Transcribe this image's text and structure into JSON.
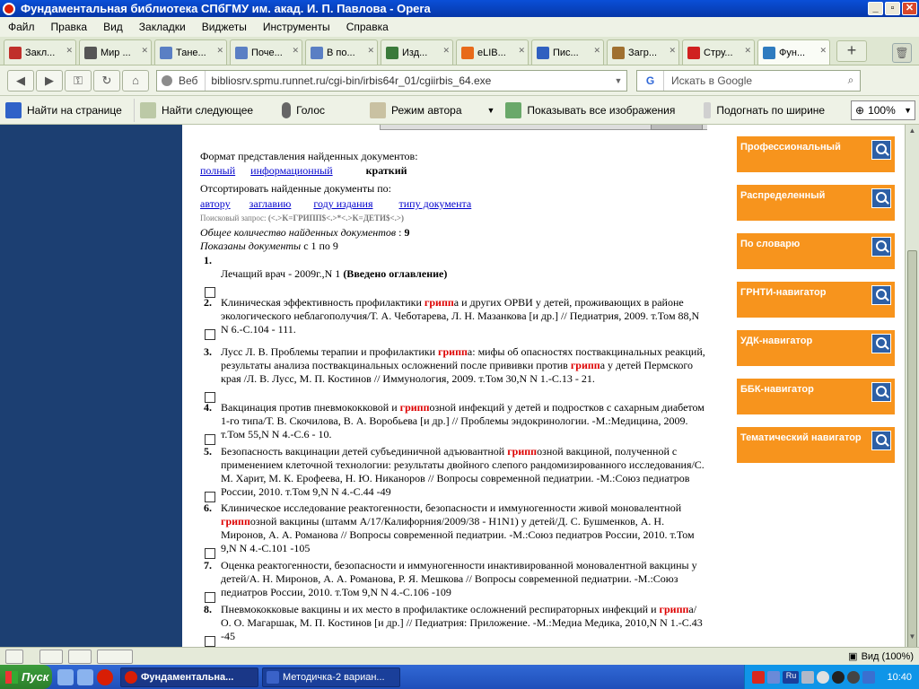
{
  "window": {
    "title": "Фундаментальная библиотека СПбГМУ им. акад. И. П. Павлова - Opera"
  },
  "menu": [
    "Файл",
    "Правка",
    "Вид",
    "Закладки",
    "Виджеты",
    "Инструменты",
    "Справка"
  ],
  "tabs": [
    {
      "label": "Закл...",
      "color": "#c0302b"
    },
    {
      "label": "Мир ...",
      "color": "#555"
    },
    {
      "label": "Тане...",
      "color": "#5a7fc4"
    },
    {
      "label": "Поче...",
      "color": "#5a7fc4"
    },
    {
      "label": "В по...",
      "color": "#5a7fc4"
    },
    {
      "label": "Изд...",
      "color": "#3a7a3a"
    },
    {
      "label": "eLIB...",
      "color": "#e86a1a"
    },
    {
      "label": "Пис...",
      "color": "#3060c0"
    },
    {
      "label": "Загр...",
      "color": "#a07030"
    },
    {
      "label": "Стру...",
      "color": "#d02020"
    },
    {
      "label": "Фун...",
      "color": "#2e7bbf"
    }
  ],
  "address": {
    "label": "Веб",
    "url": "bibliosrv.spmu.runnet.ru/cgi-bin/irbis64r_01/cgiirbis_64.exe"
  },
  "search": {
    "placeholder": "Искать в Google",
    "engine": "G"
  },
  "toolbar2": {
    "find": "Найти на странице",
    "find_next": "Найти следующее",
    "voice": "Голос",
    "author_mode": "Режим автора",
    "show_images": "Показывать все изображения",
    "fit_width": "Подогнать по ширине",
    "zoom": "100%"
  },
  "content": {
    "format_label": "Формат представления найденных документов:",
    "formats": [
      "полный",
      "информационный"
    ],
    "format_current": "краткий",
    "sort_label": "Отсортировать найденные документы по:",
    "sort_links": [
      "автору",
      "заглавию",
      "году издания",
      "типу документа"
    ],
    "query_label": "Поисковый запрос:",
    "query": "(<.>K=ГРИПП$<.>*<.>K=ДЕТИ$<.>)",
    "total_label": "Общее количество найденных документов",
    "total": "9",
    "shown": "Показаны документы",
    "shown_range": "с 1 по 9"
  },
  "records": [
    {
      "n": "1.",
      "parts": [
        {
          "t": "Лечащий врач - 2009г.,N 1 "
        },
        {
          "t": "(Введено оглавление)",
          "b": true
        }
      ]
    },
    {
      "n": "2.",
      "parts": [
        {
          "t": "Клиническая эффективность профилактики "
        },
        {
          "t": "грипп",
          "h": true
        },
        {
          "t": "а и других ОРВИ у детей, проживающих в районе экологического неблагополучия/Т. А. Чеботарева, Л. Н. Мазанкова [и др.] // Педиатрия, 2009. т.Том 88,N N 6.-С.104 - 111."
        }
      ]
    },
    {
      "n": "3.",
      "parts": [
        {
          "t": "Лусс Л. В. Проблемы терапии и профилактики "
        },
        {
          "t": "грипп",
          "h": true
        },
        {
          "t": "а: мифы об опасностях поствакцинальных реакций, результаты анализа поствакцинальных осложнений после прививки против "
        },
        {
          "t": "грипп",
          "h": true
        },
        {
          "t": "а у детей Пермского края /Л. В. Лусс, М. П. Костинов // Иммунология, 2009. т.Том 30,N N 1.-С.13 - 21."
        }
      ]
    },
    {
      "n": "4.",
      "parts": [
        {
          "t": "Вакцинация против пневмококковой и "
        },
        {
          "t": "грипп",
          "h": true
        },
        {
          "t": "озной инфекций у детей и подростков с сахарным диабетом 1-го типа/Т. В. Скочилова, В. А. Воробьева [и др.] // Проблемы эндокринологии. -М.:Медицина, 2009. т.Том 55,N N 4.-С.6 - 10."
        }
      ]
    },
    {
      "n": "5.",
      "parts": [
        {
          "t": "Безопасность вакцинации детей субъединичной адъювантной "
        },
        {
          "t": "грипп",
          "h": true
        },
        {
          "t": "озной вакциной, полученной с применением клеточной технологии: результаты двойного слепого рандомизированного исследования/С. М. Харит, М. К. Ерофеева, Н. Ю. Никаноров // Вопросы современной педиатрии. -М.:Союз педиатров России, 2010. т.Том 9,N N 4.-С.44 -49"
        }
      ]
    },
    {
      "n": "6.",
      "parts": [
        {
          "t": "Клиническое исследование реактогенности, безопасности и иммуногенности живой моновалентной "
        },
        {
          "t": "грипп",
          "h": true
        },
        {
          "t": "озной вакцины (штамм А/17/Калифорния/2009/38 - H1N1) у детей/Д. С. Бушменков, А. Н. Миронов, А. А. Романова // Вопросы современной педиатрии. -М.:Союз педиатров России, 2010. т.Том 9,N N 4.-С.101 -105"
        }
      ]
    },
    {
      "n": "7.",
      "parts": [
        {
          "t": "Оценка реактогенности, безопасности и иммуногенности инактивированной моновалентной вакцины у детей/А. Н. Миронов, А. А. Романова, Р. Я. Мешкова // Вопросы современной педиатрии. -М.:Союз педиатров России, 2010. т.Том 9,N N 4.-С.106 -109"
        }
      ]
    },
    {
      "n": "8.",
      "parts": [
        {
          "t": "Пневмококковые вакцины и их место в профилактике осложнений респираторных инфекций и "
        },
        {
          "t": "грипп",
          "h": true
        },
        {
          "t": "а/О. О. Магаршак, М. П. Костинов [и др.] // Педиатрия: Приложение. -М.:Медиа Медика, 2010,N N 1.-С.43 -45"
        }
      ]
    }
  ],
  "sidebar": [
    "Профессиональный",
    "Распределенный",
    "По словарю",
    "ГРНТИ-навигатор",
    "УДК-навигатор",
    "ББК-навигатор",
    "Тематический навигатор"
  ],
  "statusbar": {
    "view": "Вид (100%)"
  },
  "taskbar": {
    "start": "Пуск",
    "tasks": [
      "Фундаментальна...",
      "Методичка-2 вариан..."
    ],
    "lang": "Ru",
    "clock": "10:40"
  }
}
